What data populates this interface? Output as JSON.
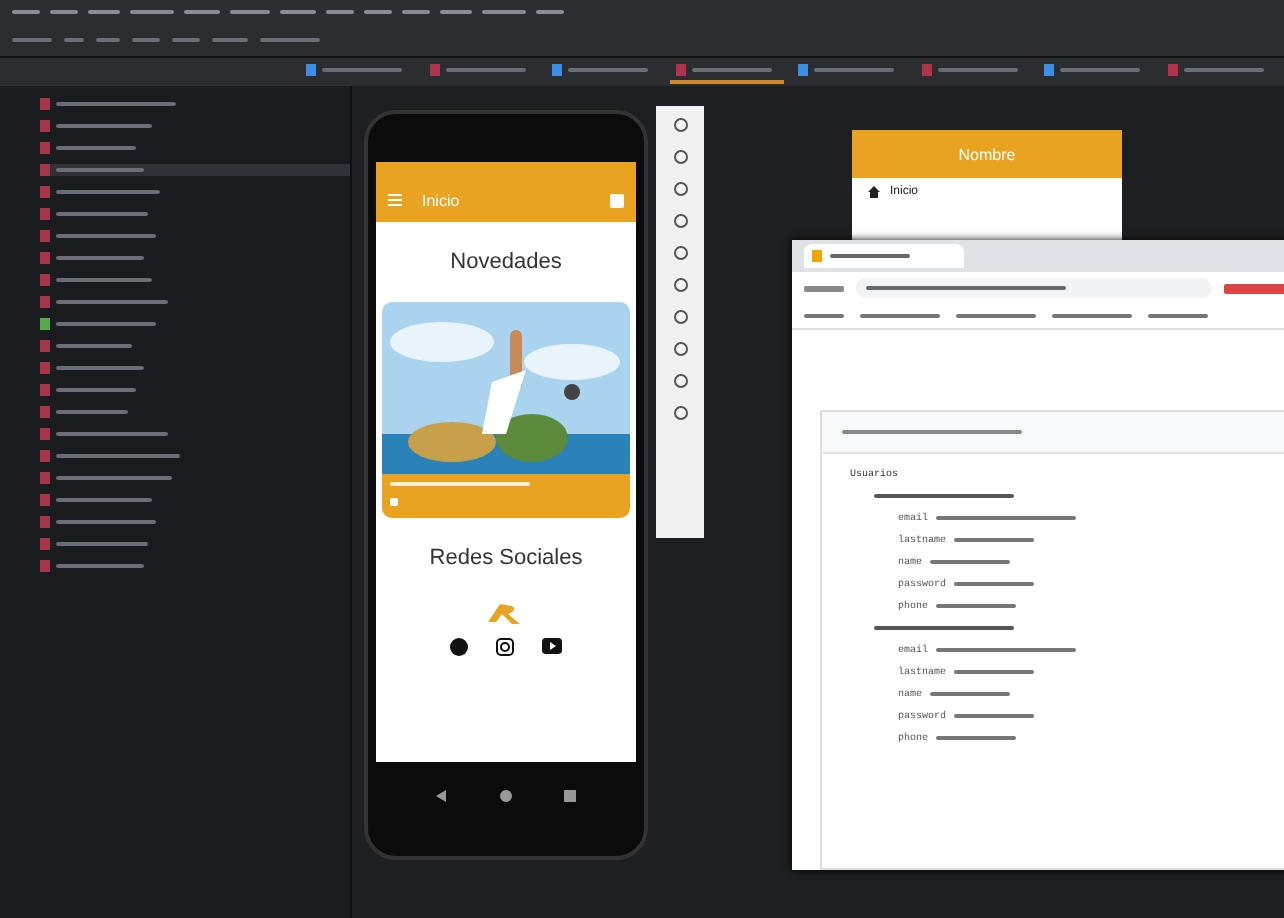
{
  "editor_tabs": [
    {
      "selected": false
    },
    {
      "selected": false
    },
    {
      "selected": false
    },
    {
      "selected": true
    },
    {
      "selected": false
    },
    {
      "selected": false
    },
    {
      "selected": false
    },
    {
      "selected": false
    }
  ],
  "phone_app": {
    "title": "Inicio",
    "sections": [
      "Novedades",
      "Redes Sociales"
    ]
  },
  "drawer_preview": {
    "header": "Nombre",
    "item": "Inicio"
  },
  "database": {
    "root": "Usuarios",
    "records": [
      {
        "fields": [
          {
            "key": "email"
          },
          {
            "key": "lastname"
          },
          {
            "key": "name"
          },
          {
            "key": "password"
          },
          {
            "key": "phone"
          }
        ]
      },
      {
        "fields": [
          {
            "key": "email"
          },
          {
            "key": "lastname"
          },
          {
            "key": "name"
          },
          {
            "key": "password"
          },
          {
            "key": "phone"
          }
        ]
      }
    ]
  }
}
